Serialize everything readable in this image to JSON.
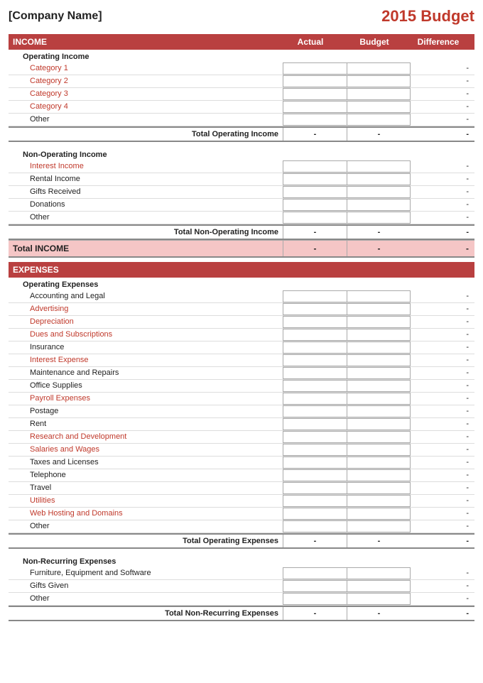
{
  "header": {
    "company_name": "[Company Name]",
    "budget_title": "2015 Budget"
  },
  "income_section": {
    "label": "INCOME",
    "col_actual": "Actual",
    "col_budget": "Budget",
    "col_difference": "Difference",
    "operating_income": {
      "label": "Operating Income",
      "items": [
        {
          "label": "Category 1",
          "color": "red"
        },
        {
          "label": "Category 2",
          "color": "red"
        },
        {
          "label": "Category 3",
          "color": "red"
        },
        {
          "label": "Category 4",
          "color": "red"
        },
        {
          "label": "Other",
          "color": "black"
        }
      ],
      "total_label": "Total Operating Income",
      "total_actual": "-",
      "total_budget": "-",
      "total_diff": "-"
    },
    "non_operating_income": {
      "label": "Non-Operating Income",
      "items": [
        {
          "label": "Interest Income",
          "color": "red"
        },
        {
          "label": "Rental Income",
          "color": "black"
        },
        {
          "label": "Gifts Received",
          "color": "black"
        },
        {
          "label": "Donations",
          "color": "black"
        },
        {
          "label": "Other",
          "color": "black"
        }
      ],
      "total_label": "Total Non-Operating Income",
      "total_actual": "-",
      "total_budget": "-",
      "total_diff": "-"
    },
    "total_label": "Total INCOME",
    "total_actual": "-",
    "total_budget": "-",
    "total_diff": "-"
  },
  "expenses_section": {
    "label": "EXPENSES",
    "operating_expenses": {
      "label": "Operating Expenses",
      "items": [
        {
          "label": "Accounting and Legal",
          "color": "black"
        },
        {
          "label": "Advertising",
          "color": "red"
        },
        {
          "label": "Depreciation",
          "color": "red"
        },
        {
          "label": "Dues and Subscriptions",
          "color": "red"
        },
        {
          "label": "Insurance",
          "color": "black"
        },
        {
          "label": "Interest Expense",
          "color": "red"
        },
        {
          "label": "Maintenance and Repairs",
          "color": "black"
        },
        {
          "label": "Office Supplies",
          "color": "black"
        },
        {
          "label": "Payroll Expenses",
          "color": "red"
        },
        {
          "label": "Postage",
          "color": "black"
        },
        {
          "label": "Rent",
          "color": "black"
        },
        {
          "label": "Research and Development",
          "color": "red"
        },
        {
          "label": "Salaries and Wages",
          "color": "red"
        },
        {
          "label": "Taxes and Licenses",
          "color": "black"
        },
        {
          "label": "Telephone",
          "color": "black"
        },
        {
          "label": "Travel",
          "color": "black"
        },
        {
          "label": "Utilities",
          "color": "red"
        },
        {
          "label": "Web Hosting and Domains",
          "color": "red"
        },
        {
          "label": "Other",
          "color": "black"
        }
      ],
      "total_label": "Total Operating Expenses",
      "total_actual": "-",
      "total_budget": "-",
      "total_diff": "-"
    },
    "non_recurring_expenses": {
      "label": "Non-Recurring Expenses",
      "items": [
        {
          "label": "Furniture, Equipment and Software",
          "color": "black"
        },
        {
          "label": "Gifts Given",
          "color": "black"
        },
        {
          "label": "Other",
          "color": "black"
        }
      ],
      "total_label": "Total Non-Recurring Expenses",
      "total_actual": "-",
      "total_budget": "-",
      "total_diff": "-"
    }
  },
  "dash": "-"
}
